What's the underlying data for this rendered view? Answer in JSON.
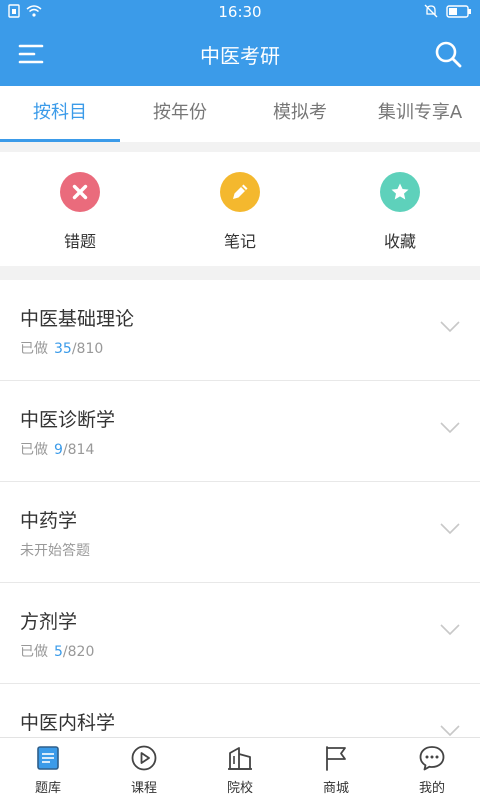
{
  "status_bar": {
    "time": "16:30"
  },
  "header": {
    "title": "中医考研"
  },
  "tabs": [
    {
      "label": "按科目",
      "active": true
    },
    {
      "label": "按年份",
      "active": false
    },
    {
      "label": "模拟考",
      "active": false
    },
    {
      "label": "集训专享A",
      "active": false
    }
  ],
  "quick_actions": [
    {
      "label": "错题",
      "icon": "close-icon",
      "color": "#ea6b7c"
    },
    {
      "label": "笔记",
      "icon": "pencil-icon",
      "color": "#f4b82e"
    },
    {
      "label": "收藏",
      "icon": "star-icon",
      "color": "#5ed1bb"
    }
  ],
  "subjects": [
    {
      "name": "中医基础理论",
      "prefix": "已做",
      "done": "35",
      "total": "/810"
    },
    {
      "name": "中医诊断学",
      "prefix": "已做",
      "done": "9",
      "total": "/814"
    },
    {
      "name": "中药学",
      "prefix": "未开始答题",
      "done": "",
      "total": ""
    },
    {
      "name": "方剂学",
      "prefix": "已做",
      "done": "5",
      "total": "/820"
    },
    {
      "name": "中医内科学",
      "prefix": "",
      "done": "",
      "total": ""
    }
  ],
  "bottom_nav": [
    {
      "label": "题库",
      "icon": "question-bank-icon",
      "active": true
    },
    {
      "label": "课程",
      "icon": "play-icon",
      "active": false
    },
    {
      "label": "院校",
      "icon": "building-icon",
      "active": false
    },
    {
      "label": "商城",
      "icon": "flag-icon",
      "active": false
    },
    {
      "label": "我的",
      "icon": "chat-bubble-icon",
      "active": false
    }
  ],
  "colors": {
    "accent": "#3b9be9",
    "error": "#ea6b7c",
    "note": "#f4b82e",
    "favorite": "#5ed1bb"
  }
}
